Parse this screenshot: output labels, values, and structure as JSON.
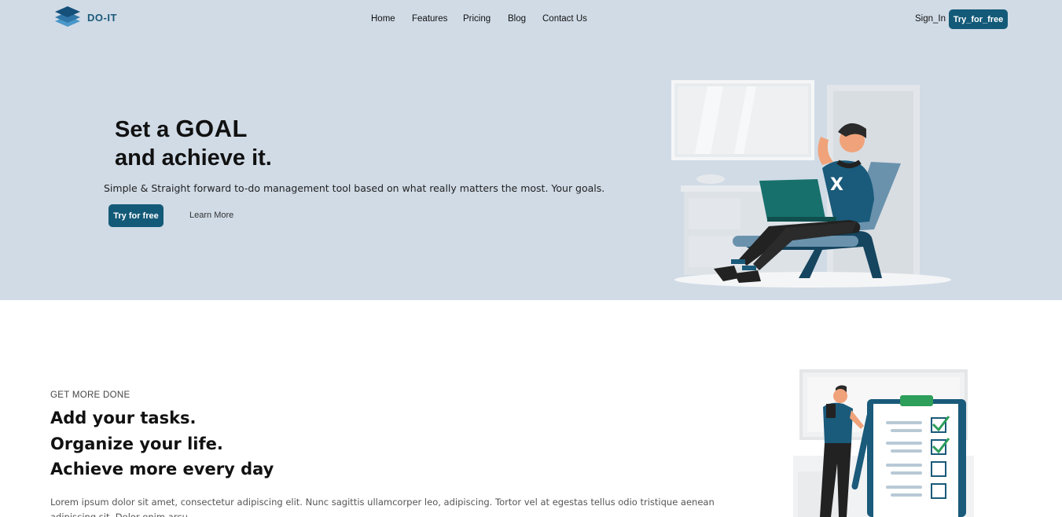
{
  "brand": {
    "name": "DO-IT",
    "logo_icon": "layers-stack-icon",
    "color": "#1a5a7a"
  },
  "nav": {
    "items": [
      "Home",
      "Features",
      "Pricing",
      "Blog",
      "Contact Us"
    ],
    "sign_in": "Sign_In",
    "cta": "Try_for_free"
  },
  "hero": {
    "title_part1": "Set a ",
    "title_highlight": "GOAL",
    "title_line2": "and achieve it.",
    "subtitle": "Simple & Straight forward to-do management tool based on what really matters the most. Your goals.",
    "primary_button": "Try for free",
    "secondary_link": "Learn More",
    "illustration": "man-with-laptop-in-chair-illustration",
    "background": "#d0dbe6"
  },
  "section": {
    "eyebrow": "GET MORE DONE",
    "title_lines": [
      "Add your tasks.",
      "Organize your life.",
      "Achieve more every day"
    ],
    "body": "Lorem ipsum dolor sit amet, consectetur adipiscing elit. Nunc sagittis ullamcorper leo, adipiscing. Tortor vel at egestas tellus odio tristique aenean adipiscing sit. Dolor enim arcu",
    "illustration": "man-with-checklist-clipboard-illustration"
  },
  "colors": {
    "accent": "#135a78",
    "check_green": "#2e9e5b"
  }
}
